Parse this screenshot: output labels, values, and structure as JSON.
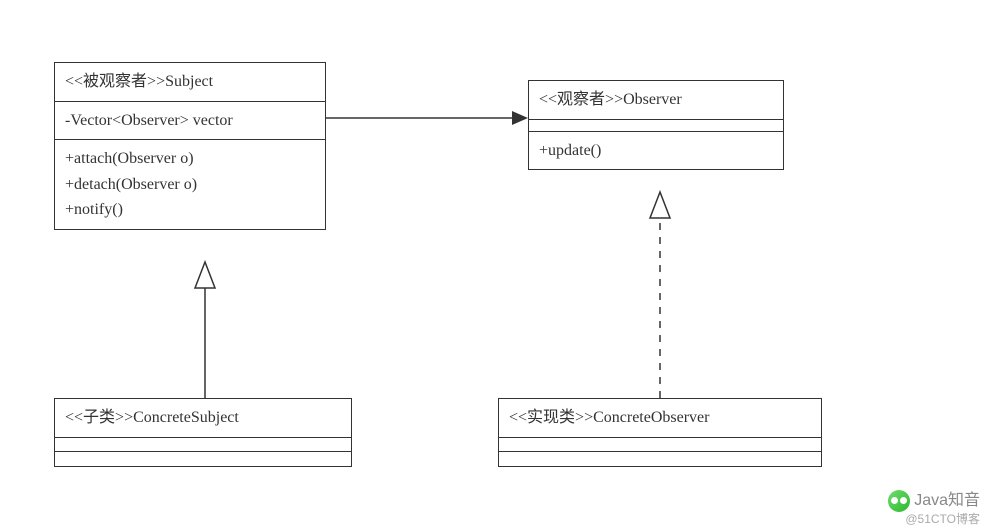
{
  "subject": {
    "title": "<<被观察者>>Subject",
    "attr": "-Vector<Observer> vector",
    "op1": "+attach(Observer o)",
    "op2": "+detach(Observer o)",
    "op3": "+notify()"
  },
  "observer": {
    "title": "<<观察者>>Observer",
    "op1": "+update()"
  },
  "concrete_subject": {
    "title": "<<子类>>ConcreteSubject"
  },
  "concrete_observer": {
    "title": "<<实现类>>ConcreteObserver"
  },
  "watermark": {
    "brand": "Java知音",
    "sub": "@51CTO博客"
  },
  "relations": [
    {
      "from": "Subject",
      "to": "Observer",
      "type": "association-arrow"
    },
    {
      "from": "ConcreteSubject",
      "to": "Subject",
      "type": "generalization"
    },
    {
      "from": "ConcreteObserver",
      "to": "Observer",
      "type": "realization"
    }
  ]
}
